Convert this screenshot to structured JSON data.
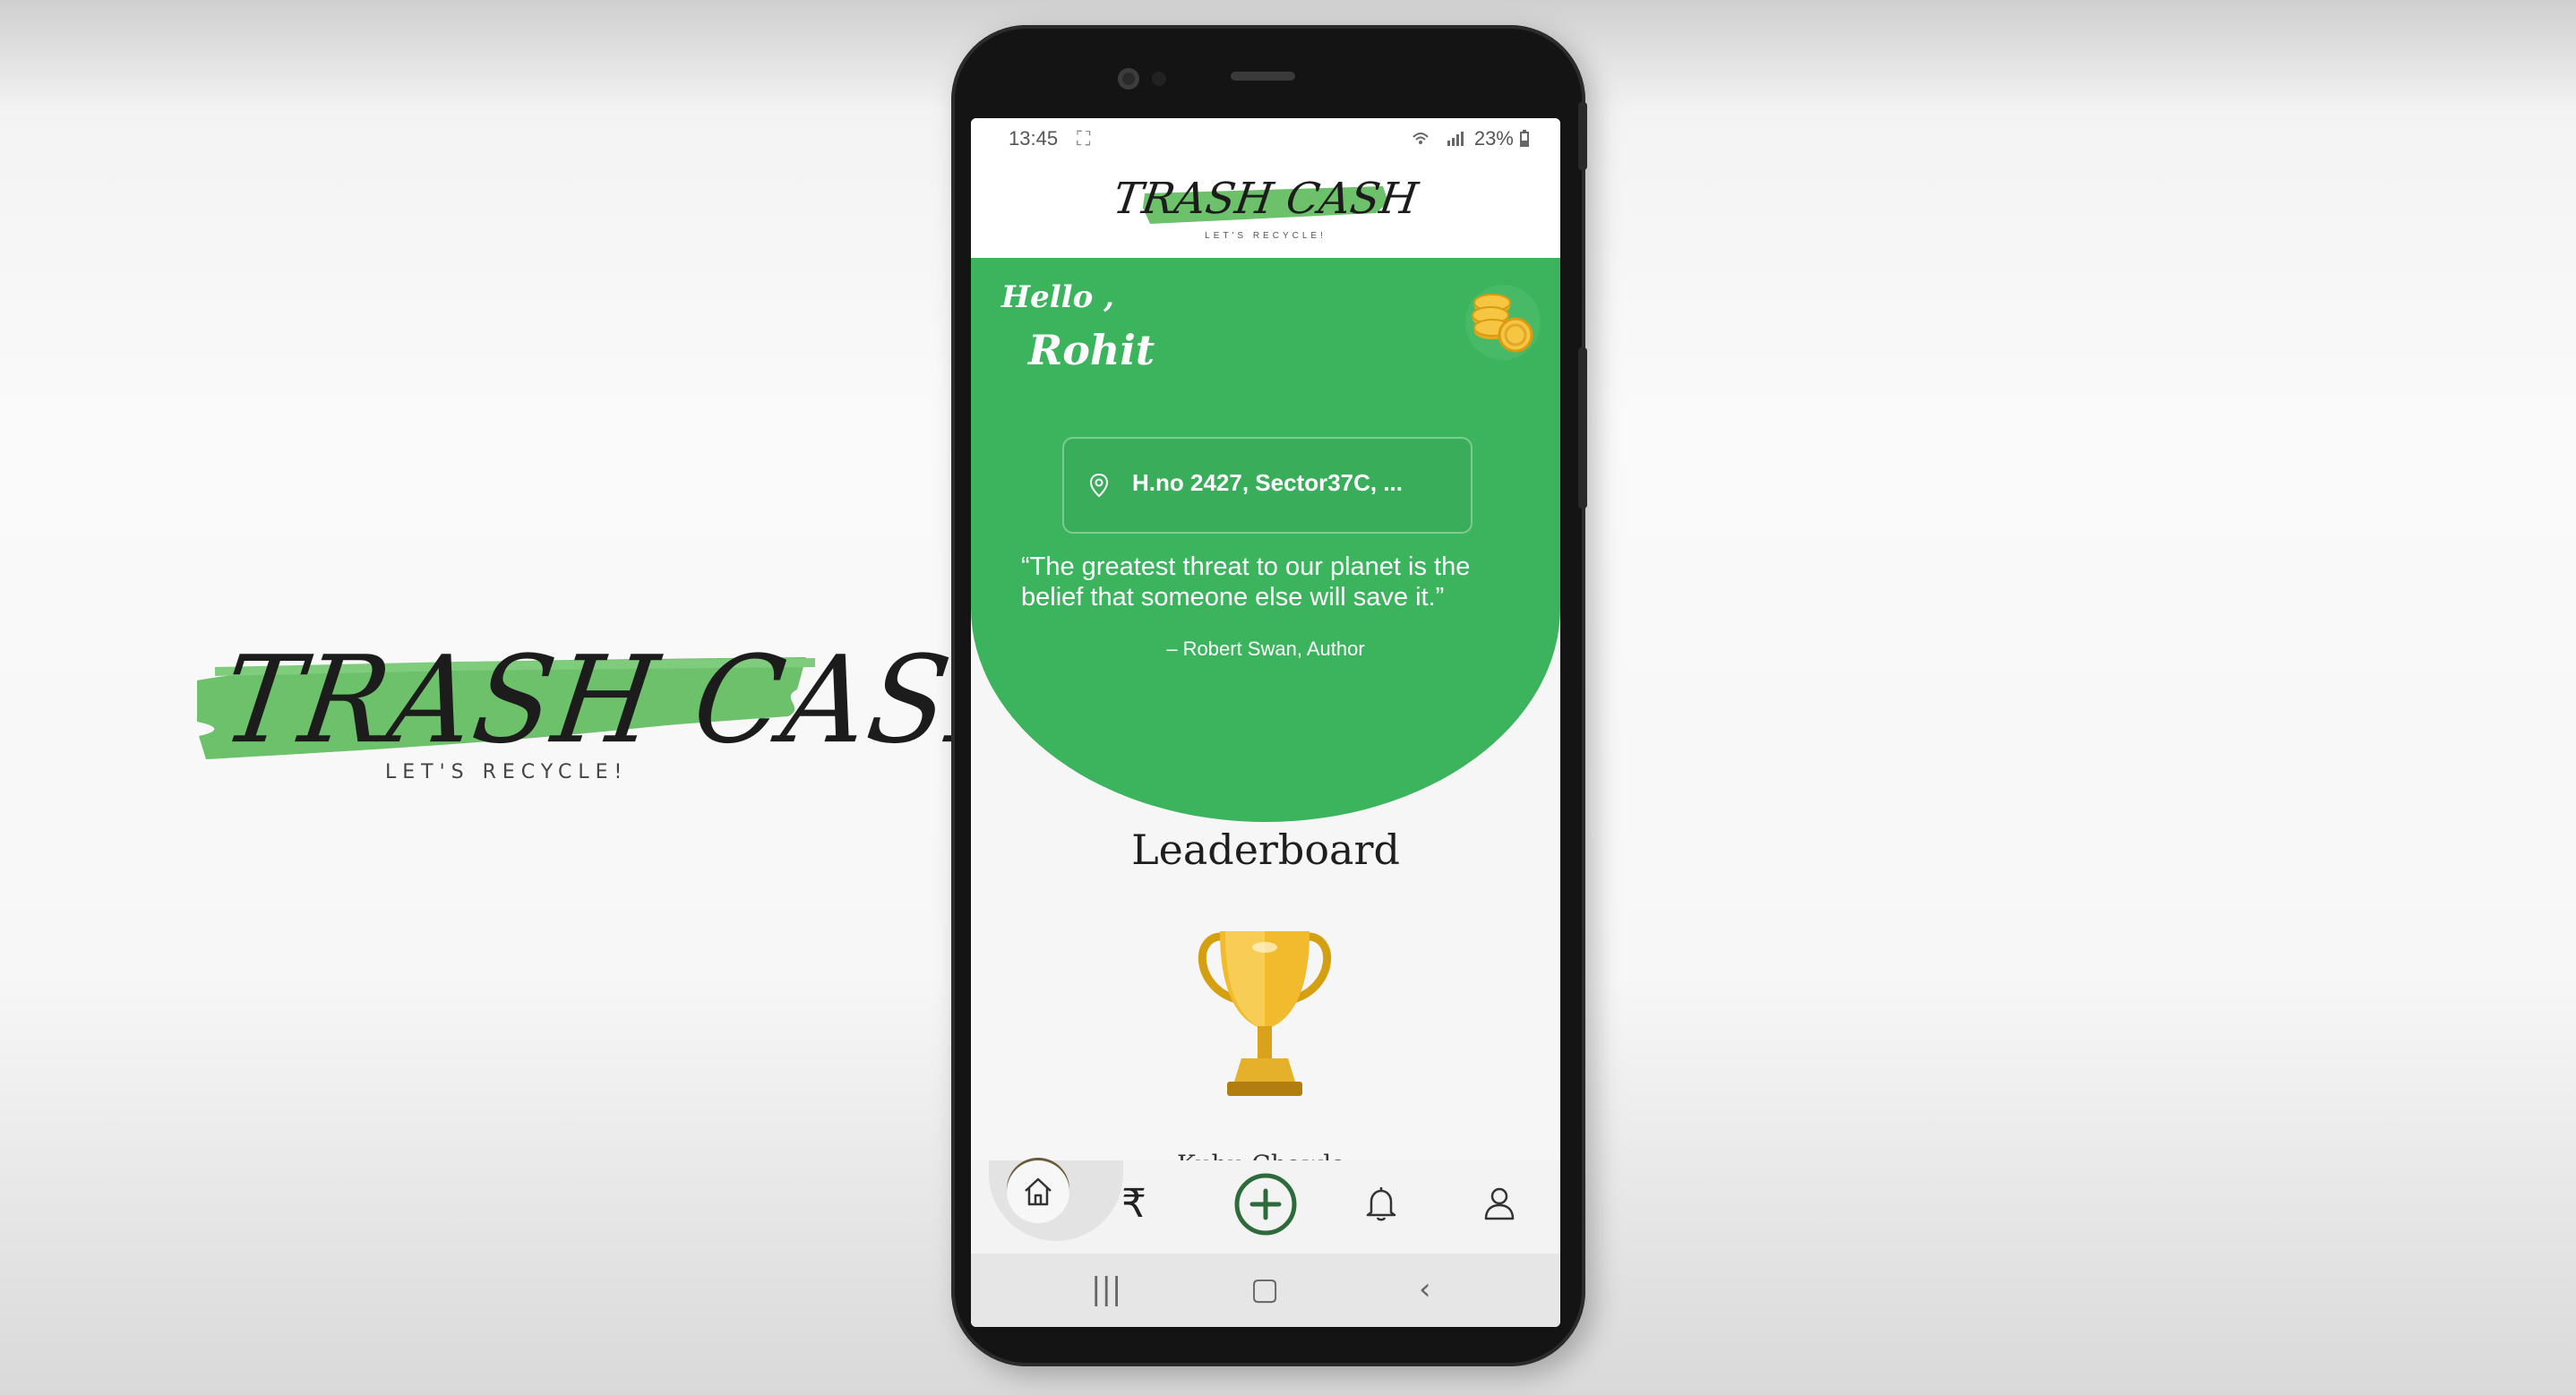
{
  "brand": {
    "name": "TRASH CASH",
    "tagline": "LET'S RECYCLE!",
    "brush_color": "#6cc16a"
  },
  "status_bar": {
    "time": "13:45",
    "time_icon": "⛶",
    "right": "23%"
  },
  "greeting": {
    "hello": "Hello ,",
    "name": "Rohit"
  },
  "address": {
    "icon": "location-pin-icon",
    "text": "H.no 2427, Sector37C, ..."
  },
  "quote": {
    "text": "“The greatest threat to our planet is the belief that someone else will save it.”",
    "author": "– Robert Swan, Author"
  },
  "leaderboard": {
    "title": "Leaderboard",
    "partial_name": "Kuhu Chawla",
    "partial_dots": "..."
  },
  "nav": {
    "items": [
      "home-icon",
      "rupee-icon",
      "add-icon",
      "bell-icon",
      "user-icon"
    ],
    "rupee_glyph": "₹",
    "active": "home"
  },
  "system_nav": {
    "recents": "|||",
    "home": "▢",
    "back": "‹"
  },
  "colors": {
    "primary_green": "#3cb35d",
    "nav_add_ring": "#2e6b3a"
  }
}
